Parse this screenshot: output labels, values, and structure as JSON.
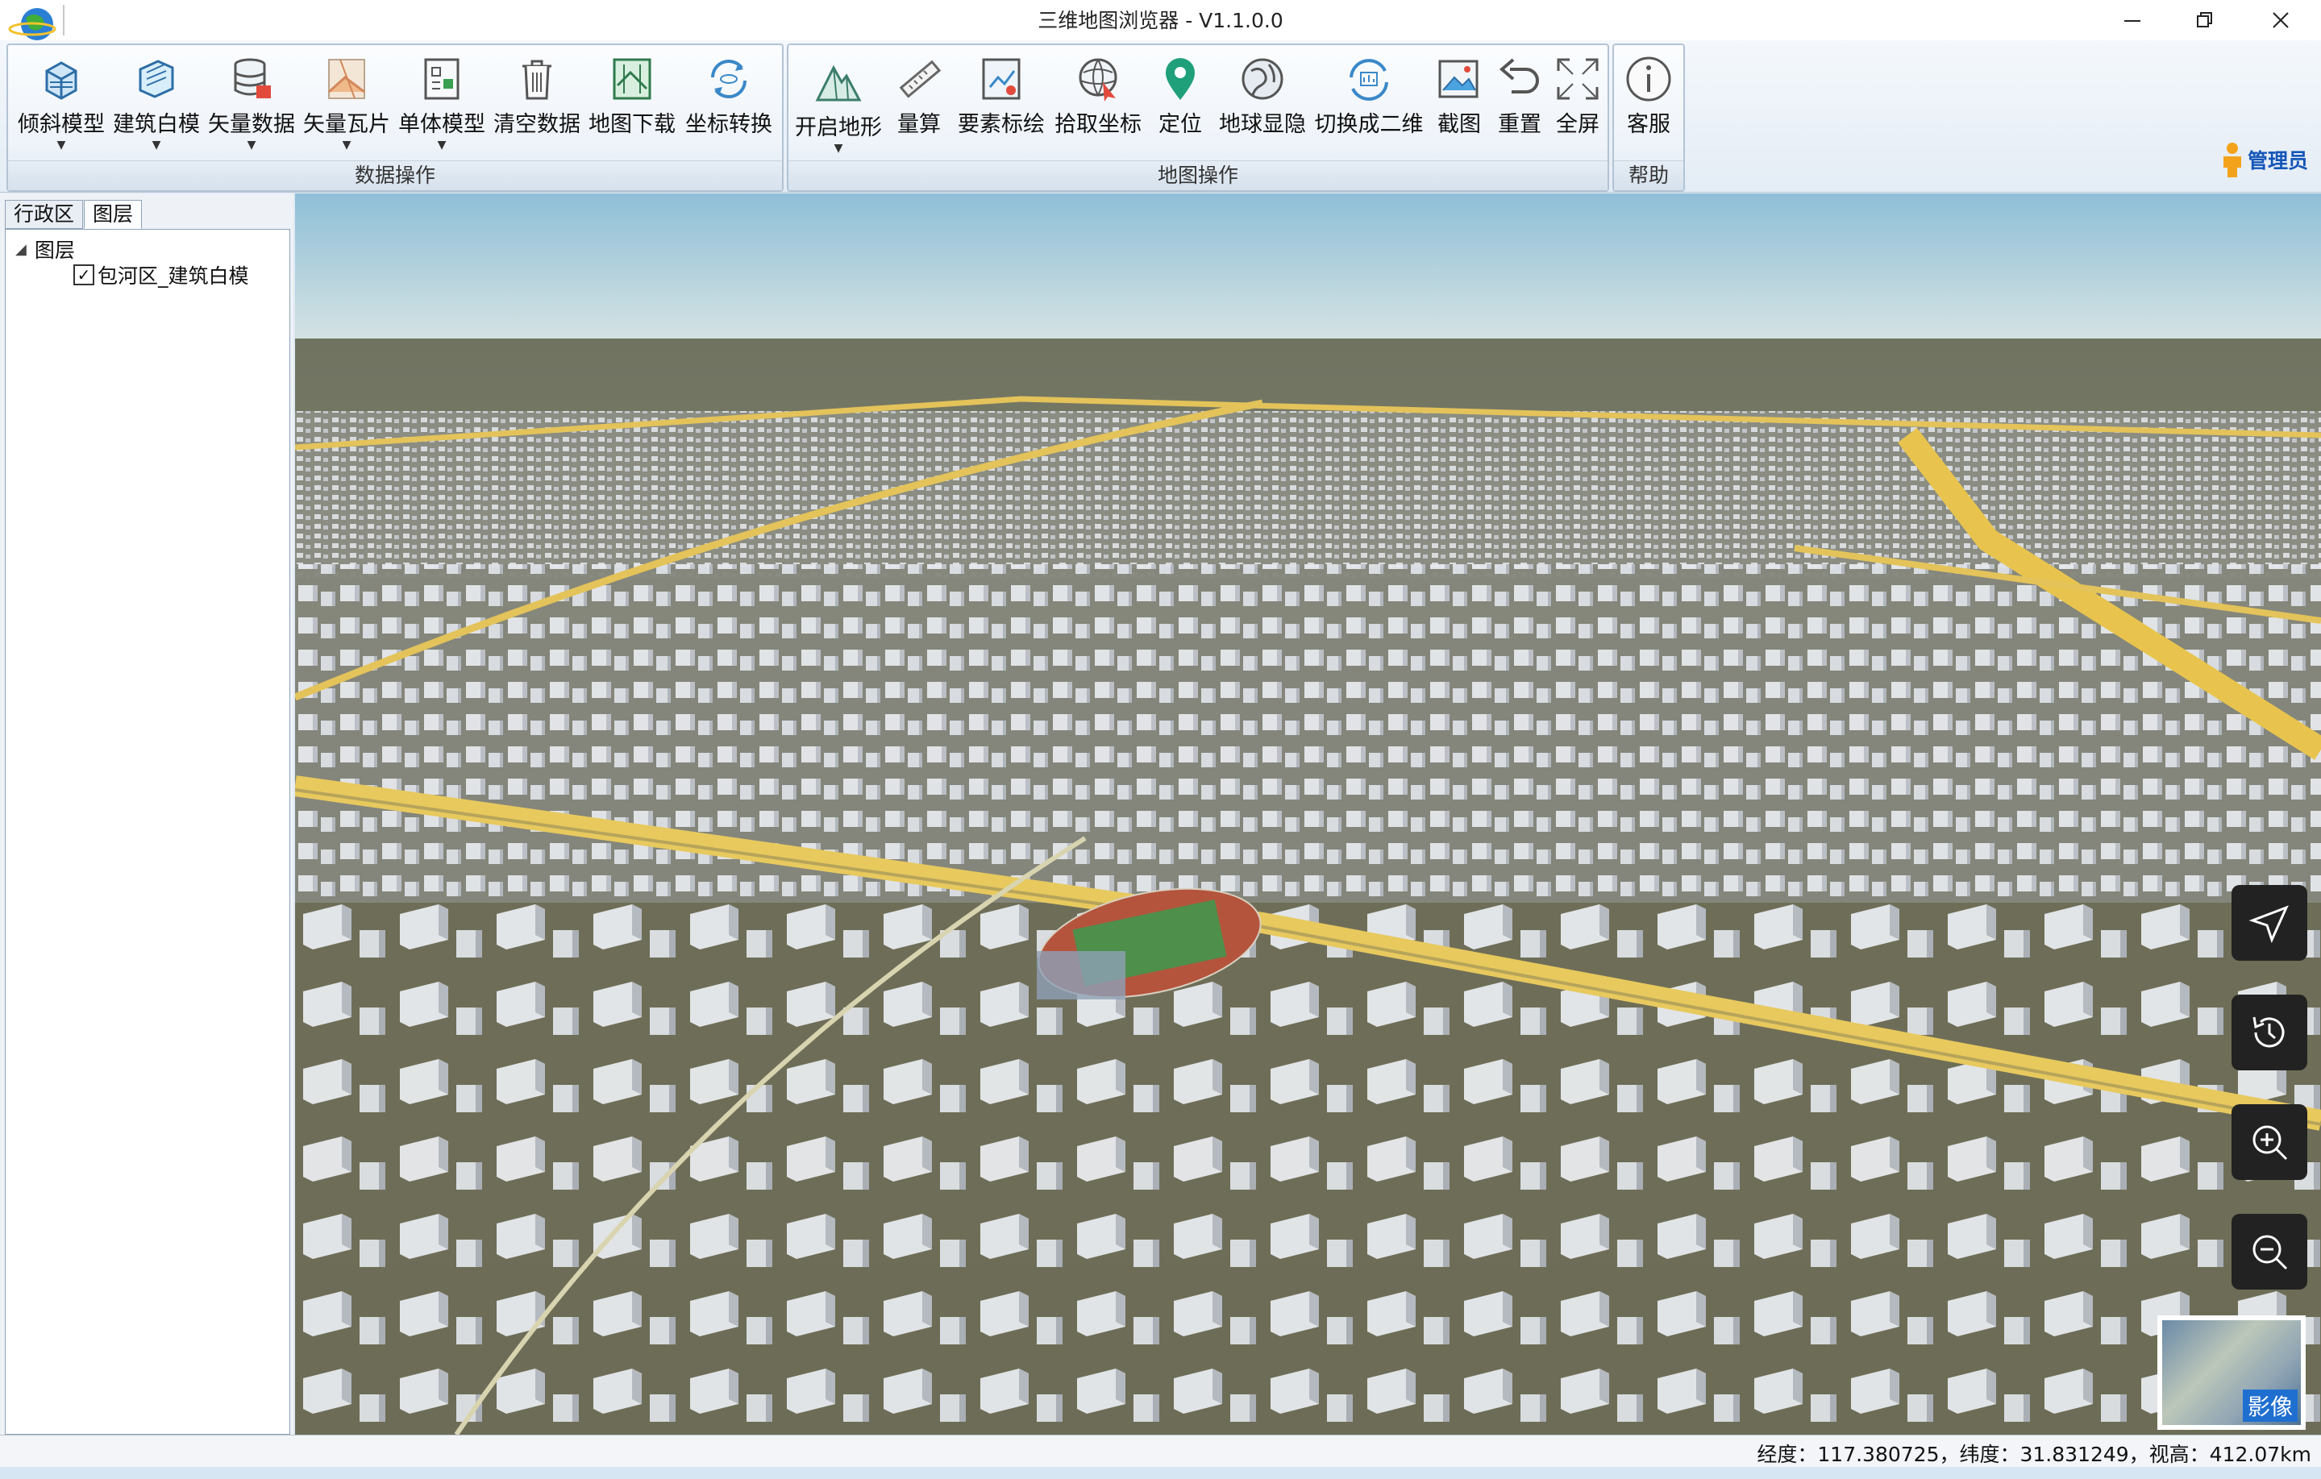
{
  "window": {
    "title": "三维地图浏览器 - V1.1.0.0"
  },
  "ribbon": {
    "groups": [
      {
        "label": "数据操作",
        "buttons": [
          {
            "label": "倾斜模型",
            "icon": "tilt-model-icon",
            "dropdown": true
          },
          {
            "label": "建筑白模",
            "icon": "building-model-icon",
            "dropdown": true
          },
          {
            "label": "矢量数据",
            "icon": "vector-data-icon",
            "dropdown": true
          },
          {
            "label": "矢量瓦片",
            "icon": "vector-tile-icon",
            "dropdown": true
          },
          {
            "label": "单体模型",
            "icon": "single-model-icon",
            "dropdown": true
          },
          {
            "label": "清空数据",
            "icon": "trash-icon",
            "dropdown": false
          },
          {
            "label": "地图下载",
            "icon": "map-download-icon",
            "dropdown": false
          },
          {
            "label": "坐标转换",
            "icon": "coordinate-convert-icon",
            "dropdown": false
          }
        ]
      },
      {
        "label": "地图操作",
        "buttons": [
          {
            "label": "开启地形",
            "icon": "terrain-icon",
            "dropdown": true
          },
          {
            "label": "量算",
            "icon": "ruler-icon",
            "dropdown": false
          },
          {
            "label": "要素标绘",
            "icon": "plot-icon",
            "dropdown": false
          },
          {
            "label": "拾取坐标",
            "icon": "pick-coordinate-icon",
            "dropdown": false
          },
          {
            "label": "定位",
            "icon": "location-pin-icon",
            "dropdown": false
          },
          {
            "label": "地球显隐",
            "icon": "globe-toggle-icon",
            "dropdown": false
          },
          {
            "label": "切换成二维",
            "icon": "switch-2d-icon",
            "dropdown": false
          },
          {
            "label": "截图",
            "icon": "screenshot-icon",
            "dropdown": false
          },
          {
            "label": "重置",
            "icon": "undo-icon",
            "dropdown": false
          },
          {
            "label": "全屏",
            "icon": "fullscreen-icon",
            "dropdown": false
          }
        ]
      },
      {
        "label": "帮助",
        "buttons": [
          {
            "label": "客服",
            "icon": "info-icon",
            "dropdown": false
          }
        ]
      }
    ],
    "user": {
      "label": "管理员",
      "icon": "user-icon"
    }
  },
  "left_panel": {
    "tabs": [
      {
        "label": "行政区",
        "active": false
      },
      {
        "label": "图层",
        "active": true
      }
    ],
    "tree": {
      "root": "图层",
      "children": [
        {
          "label": "包河区_建筑白模",
          "checked": true
        }
      ]
    }
  },
  "map": {
    "nav_buttons": [
      "compass-arrow-icon",
      "history-icon",
      "zoom-in-icon",
      "zoom-out-icon"
    ],
    "basemap_label": "影像"
  },
  "status": {
    "coords": "经度：117.380725，纬度：31.831249，视高：412.07km"
  }
}
